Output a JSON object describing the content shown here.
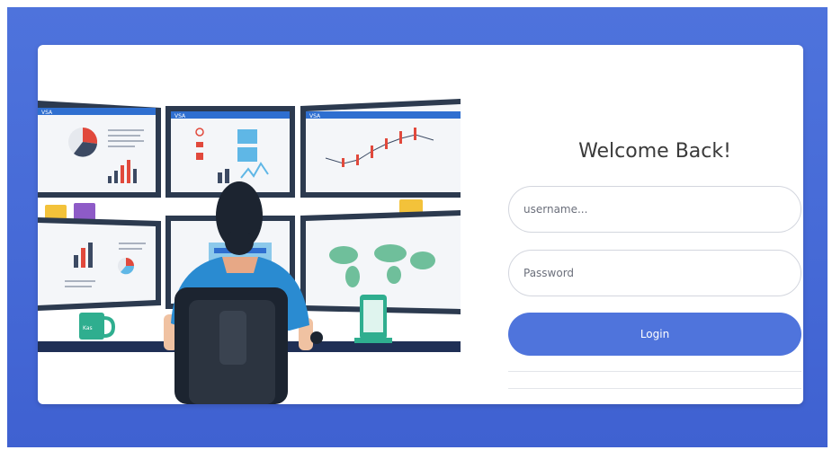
{
  "form": {
    "title": "Welcome Back!",
    "username_placeholder": "username...",
    "password_placeholder": "Password",
    "login_label": "Login"
  },
  "illustration": {
    "brand_label": "VSA",
    "mug_label": "Kas"
  },
  "colors": {
    "background": "#4e73dc",
    "button": "#4f74dc",
    "card": "#ffffff"
  }
}
